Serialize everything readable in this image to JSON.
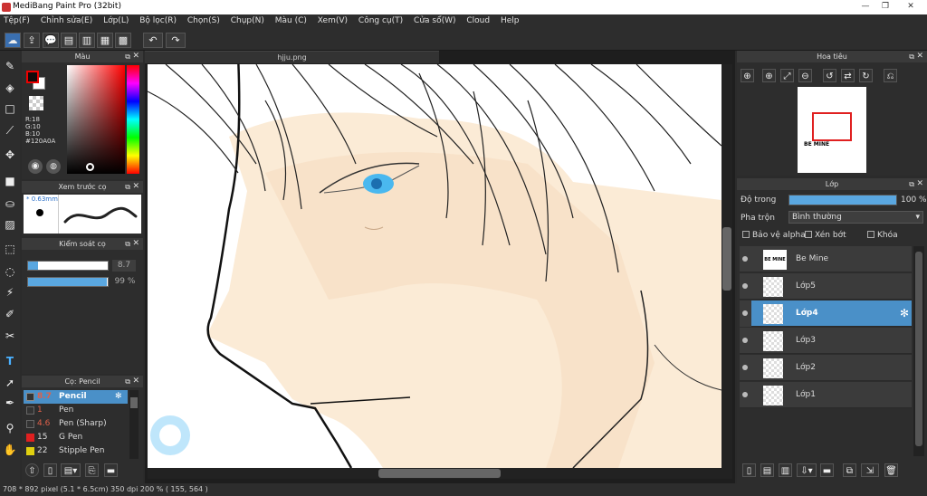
{
  "window": {
    "title": "MediBang Paint Pro (32bit)",
    "minimize": "—",
    "maximize": "❐",
    "close": "✕"
  },
  "menu": [
    "Tệp(F)",
    "Chỉnh sửa(E)",
    "Lớp(L)",
    "Bộ lọc(R)",
    "Chọn(S)",
    "Chụp(N)",
    "Màu (C)",
    "Xem(V)",
    "Công cụ(T)",
    "Cửa sổ(W)",
    "Cloud",
    "Help"
  ],
  "canvas": {
    "tab": "hjju.png"
  },
  "color_panel": {
    "title": "Màu",
    "r": "R:18",
    "g": "G:10",
    "b": "B:10",
    "hex": "#120A0A",
    "accent": "#120A0A"
  },
  "brush_preview": {
    "title": "Xem trước cọ",
    "size": "* 0.63mm"
  },
  "brush_control": {
    "title": "Kiểm soát cọ",
    "size_value": "8.7",
    "opacity_value": "99 %",
    "size_fraction": 0.12,
    "opacity_fraction": 0.99
  },
  "brush_list": {
    "title": "Cọ: Pencil",
    "items": [
      {
        "size": "8.7",
        "name": "Pencil",
        "color": "#333333",
        "selected": true
      },
      {
        "size": "1",
        "name": "Pen",
        "color": "#333333",
        "selected": false
      },
      {
        "size": "4.6",
        "name": "Pen (Sharp)",
        "color": "#333333",
        "selected": false
      },
      {
        "size": "15",
        "name": "G Pen",
        "color": "#e02020",
        "selected": false
      },
      {
        "size": "22",
        "name": "Stipple Pen",
        "color": "#e0d010",
        "selected": false
      }
    ]
  },
  "navigator": {
    "title": "Hoa tiêu",
    "thumb_text": "BE MINE"
  },
  "layers": {
    "title": "Lớp",
    "opacity_label": "Độ trong",
    "opacity_value": "100 %",
    "opacity_fraction": 1.0,
    "blend_label": "Pha trộn",
    "blend_value": "Bình thường",
    "protect_alpha": "Bảo vệ alpha",
    "clipping": "Xén bớt",
    "lock": "Khóa",
    "items": [
      {
        "name": "Be Mine",
        "selected": false,
        "thumb_text": "BE MINE"
      },
      {
        "name": "Lớp5",
        "selected": false,
        "thumb_text": ""
      },
      {
        "name": "Lớp4",
        "selected": true,
        "thumb_text": ""
      },
      {
        "name": "Lớp3",
        "selected": false,
        "thumb_text": ""
      },
      {
        "name": "Lớp2",
        "selected": false,
        "thumb_text": ""
      },
      {
        "name": "Lớp1",
        "selected": false,
        "thumb_text": ""
      }
    ]
  },
  "status": {
    "text": "708 * 892 pixel   (5.1 * 6.5cm)   350 dpi   200 %   ( 155, 564 )"
  }
}
